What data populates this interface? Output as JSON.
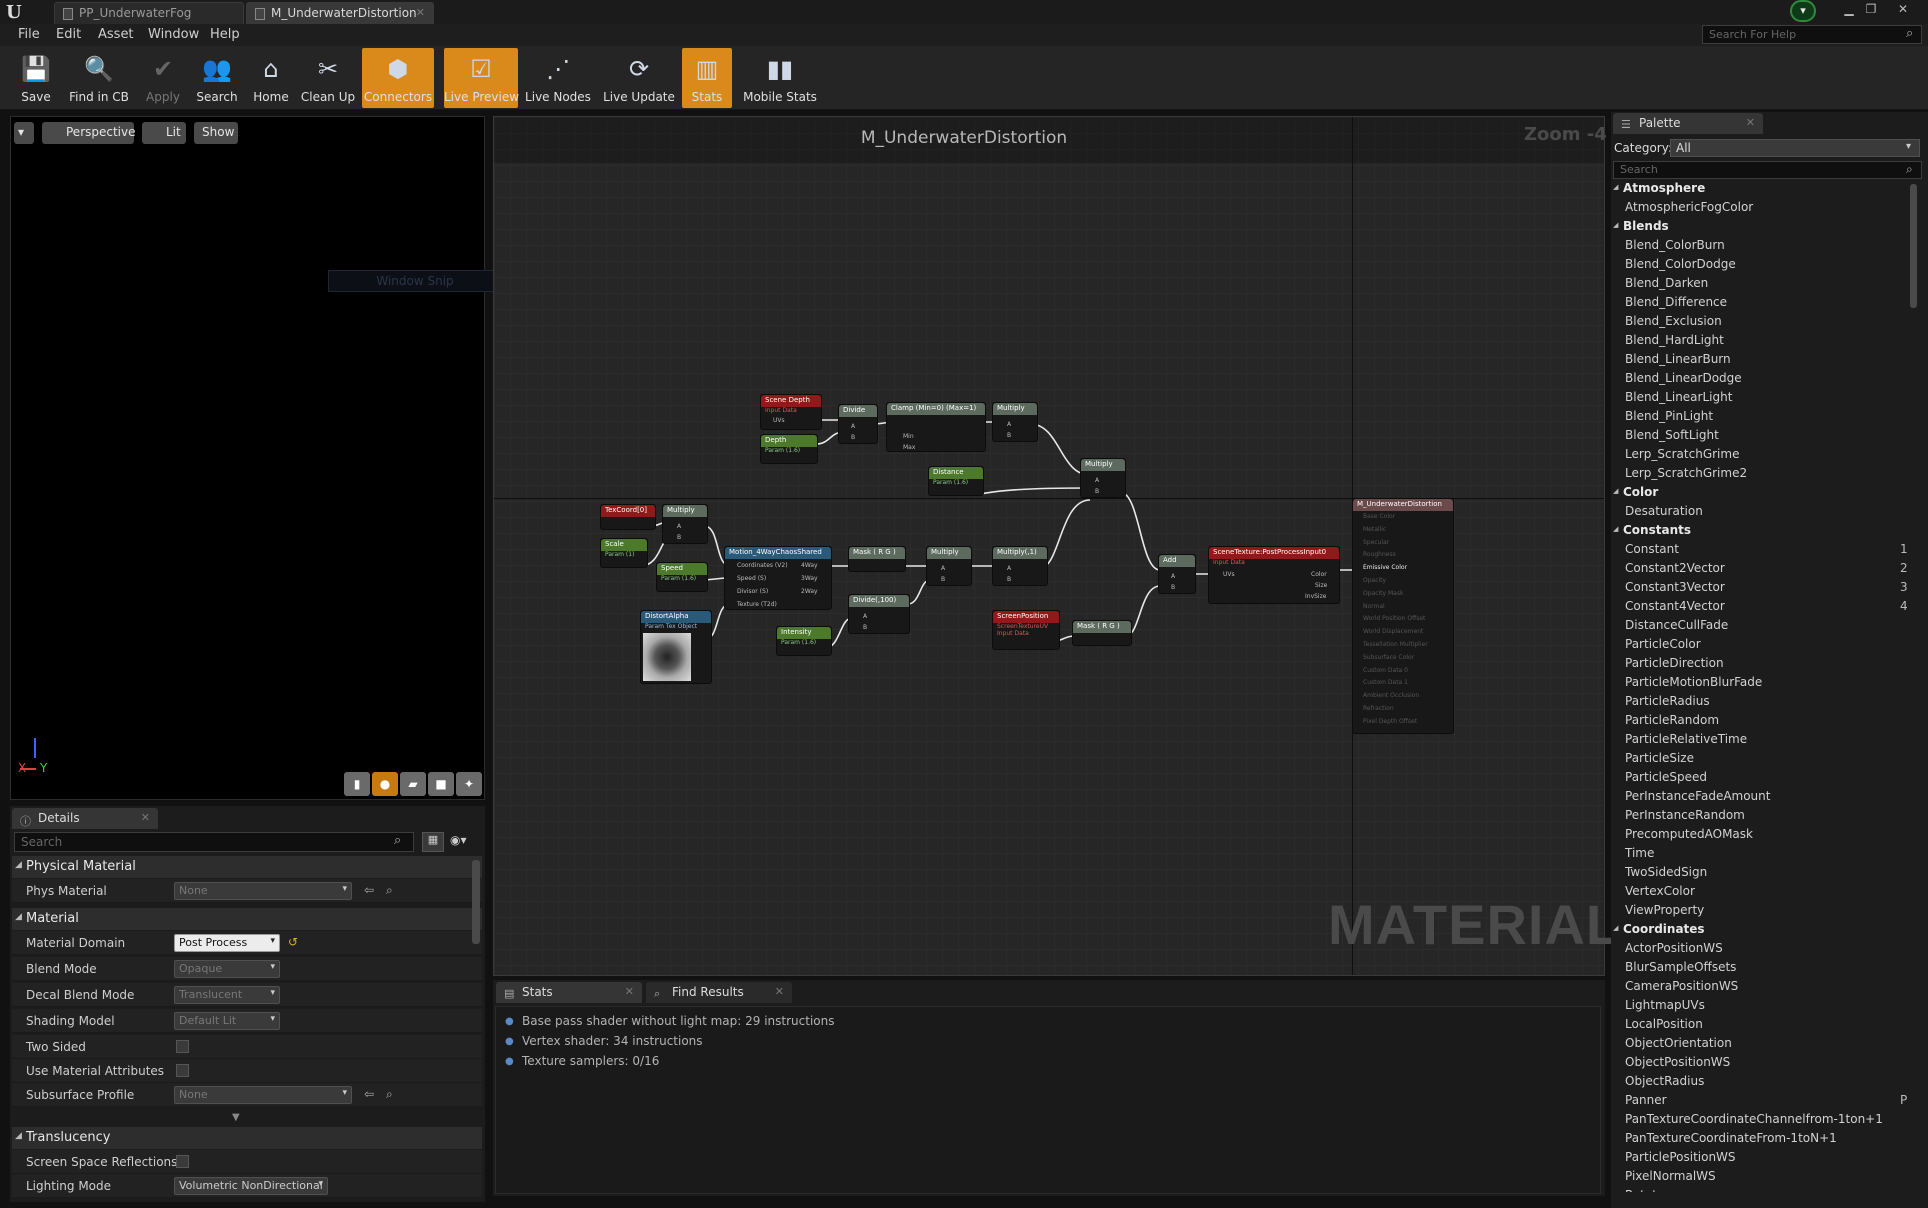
{
  "tabs": [
    {
      "label": "PP_UnderwaterFog"
    },
    {
      "label": "M_UnderwaterDistortion"
    }
  ],
  "window_controls": {
    "minimize": "▁",
    "restore": "❐",
    "close": "✕"
  },
  "menu": [
    "File",
    "Edit",
    "Asset",
    "Window",
    "Help"
  ],
  "help_search": {
    "placeholder": "Search For Help"
  },
  "toolbar": [
    {
      "label": "Save",
      "icon": "save-icon",
      "active": false
    },
    {
      "label": "Find in CB",
      "icon": "find-icon",
      "active": false
    },
    {
      "label": "Apply",
      "icon": "apply-icon",
      "active": false,
      "disabled": true
    },
    {
      "label": "Search",
      "icon": "search-icon",
      "active": false
    },
    {
      "label": "Home",
      "icon": "home-icon",
      "active": false
    },
    {
      "label": "Clean Up",
      "icon": "cleanup-icon",
      "active": false
    },
    {
      "label": "Connectors",
      "icon": "connectors-icon",
      "active": true
    },
    {
      "label": "Live Preview",
      "icon": "live-preview-icon",
      "active": true
    },
    {
      "label": "Live Nodes",
      "icon": "live-nodes-icon",
      "active": false
    },
    {
      "label": "Live Update",
      "icon": "live-update-icon",
      "active": false
    },
    {
      "label": "Stats",
      "icon": "stats-icon",
      "active": true
    },
    {
      "label": "Mobile Stats",
      "icon": "mobile-stats-icon",
      "active": false
    }
  ],
  "viewport": {
    "perspective": "Perspective",
    "lit": "Lit",
    "show": "Show",
    "window_snip": "Window Snip",
    "axis_x": "X",
    "axis_y": "Y"
  },
  "details": {
    "tab": "Details",
    "search_placeholder": "Search",
    "sections": {
      "physical_material": "Physical Material",
      "material": "Material",
      "translucency": "Translucency"
    },
    "rows": {
      "phys_material": {
        "label": "Phys Material",
        "value": "None"
      },
      "material_domain": {
        "label": "Material Domain",
        "value": "Post Process"
      },
      "blend_mode": {
        "label": "Blend Mode",
        "value": "Opaque"
      },
      "decal_blend_mode": {
        "label": "Decal Blend Mode",
        "value": "Translucent"
      },
      "shading_model": {
        "label": "Shading Model",
        "value": "Default Lit"
      },
      "two_sided": {
        "label": "Two Sided"
      },
      "use_material_attributes": {
        "label": "Use Material Attributes"
      },
      "subsurface_profile": {
        "label": "Subsurface Profile",
        "value": "None"
      },
      "screen_space_reflections": {
        "label": "Screen Space Reflections"
      },
      "lighting_mode": {
        "label": "Lighting Mode",
        "value": "Volumetric NonDirectional"
      }
    }
  },
  "graph": {
    "title": "M_UnderwaterDistortion",
    "zoom": "Zoom -4",
    "watermark": "MATERIAL",
    "nodes": {
      "scene_depth": {
        "title": "Scene Depth",
        "sub": "Input Data",
        "pins": [
          "UVs"
        ]
      },
      "depth": {
        "title": "Depth",
        "sub": "Param (1.6)"
      },
      "divide1": {
        "title": "Divide",
        "pins": [
          "A",
          "B"
        ]
      },
      "clamp": {
        "title": "Clamp (Min=0) (Max=1)",
        "pins": [
          "Min",
          "Max"
        ]
      },
      "multiply_top": {
        "title": "Multiply",
        "pins": [
          "A",
          "B"
        ]
      },
      "distance": {
        "title": "Distance",
        "sub": "Param (1.6)"
      },
      "multiply_mid": {
        "title": "Multiply",
        "pins": [
          "A",
          "B"
        ]
      },
      "texcoord": {
        "title": "TexCoord[0]"
      },
      "multiply_uv": {
        "title": "Multiply",
        "pins": [
          "A",
          "B"
        ]
      },
      "scale": {
        "title": "Scale",
        "sub": "Param (1)"
      },
      "speed": {
        "title": "Speed",
        "sub": "Param (1.6)"
      },
      "motion": {
        "title": "Motion_4WayChaosShared",
        "pins": [
          "Coordinates (V2)",
          "Speed (S)",
          "Divisor (S)",
          "Texture (T2d)",
          "4Way",
          "3Way",
          "2Way"
        ]
      },
      "mask_rg1": {
        "title": "Mask ( R G )"
      },
      "divide100": {
        "title": "Divide(,100)",
        "pins": [
          "A",
          "B"
        ]
      },
      "multiply_a": {
        "title": "Multiply",
        "pins": [
          "A",
          "B"
        ]
      },
      "multiply_1": {
        "title": "Multiply(,1)",
        "pins": [
          "A",
          "B"
        ]
      },
      "distort_alpha": {
        "title": "DistortAlpha",
        "sub": "Param Tex Object"
      },
      "intensity": {
        "title": "Intensity",
        "sub": "Param (1.6)"
      },
      "screen_position": {
        "title": "ScreenPosition",
        "sub": "ScreenTextureUV",
        "sub2": "Input Data"
      },
      "mask_rg2": {
        "title": "Mask ( R G )"
      },
      "add": {
        "title": "Add",
        "pins": [
          "A",
          "B"
        ]
      },
      "scene_texture": {
        "title": "SceneTexture:PostProcessInput0",
        "sub": "Input Data",
        "pins": [
          "UVs",
          "Color",
          "Size",
          "InvSize"
        ]
      },
      "result": {
        "title": "M_UnderwaterDistortion",
        "pins": [
          "Base Color",
          "Metallic",
          "Specular",
          "Roughness",
          "Emissive Color",
          "Opacity",
          "Opacity Mask",
          "Normal",
          "World Position Offset",
          "World Displacement",
          "Tessellation Multiplier",
          "Subsurface Color",
          "Custom Data 0",
          "Custom Data 1",
          "Ambient Occlusion",
          "Refraction",
          "Pixel Depth Offset"
        ]
      }
    }
  },
  "bottom": {
    "tabs": [
      {
        "label": "Stats"
      },
      {
        "label": "Find Results"
      }
    ],
    "stats": [
      "Base pass shader without light map: 29 instructions",
      "Vertex shader: 34 instructions",
      "Texture samplers: 0/16"
    ]
  },
  "palette": {
    "tab": "Palette",
    "category_label": "Category:",
    "category_value": "All",
    "search_placeholder": "Search",
    "items": [
      {
        "t": "cat",
        "l": "Atmosphere"
      },
      {
        "t": "i",
        "l": "AtmosphericFogColor"
      },
      {
        "t": "cat",
        "l": "Blends"
      },
      {
        "t": "i",
        "l": "Blend_ColorBurn"
      },
      {
        "t": "i",
        "l": "Blend_ColorDodge"
      },
      {
        "t": "i",
        "l": "Blend_Darken"
      },
      {
        "t": "i",
        "l": "Blend_Difference"
      },
      {
        "t": "i",
        "l": "Blend_Exclusion"
      },
      {
        "t": "i",
        "l": "Blend_HardLight"
      },
      {
        "t": "i",
        "l": "Blend_LinearBurn"
      },
      {
        "t": "i",
        "l": "Blend_LinearDodge"
      },
      {
        "t": "i",
        "l": "Blend_LinearLight"
      },
      {
        "t": "i",
        "l": "Blend_PinLight"
      },
      {
        "t": "i",
        "l": "Blend_SoftLight"
      },
      {
        "t": "i",
        "l": "Lerp_ScratchGrime"
      },
      {
        "t": "i",
        "l": "Lerp_ScratchGrime2"
      },
      {
        "t": "cat",
        "l": "Color"
      },
      {
        "t": "i",
        "l": "Desaturation"
      },
      {
        "t": "cat",
        "l": "Constants"
      },
      {
        "t": "i",
        "l": "Constant",
        "k": "1"
      },
      {
        "t": "i",
        "l": "Constant2Vector",
        "k": "2"
      },
      {
        "t": "i",
        "l": "Constant3Vector",
        "k": "3"
      },
      {
        "t": "i",
        "l": "Constant4Vector",
        "k": "4"
      },
      {
        "t": "i",
        "l": "DistanceCullFade"
      },
      {
        "t": "i",
        "l": "ParticleColor"
      },
      {
        "t": "i",
        "l": "ParticleDirection"
      },
      {
        "t": "i",
        "l": "ParticleMotionBlurFade"
      },
      {
        "t": "i",
        "l": "ParticleRadius"
      },
      {
        "t": "i",
        "l": "ParticleRandom"
      },
      {
        "t": "i",
        "l": "ParticleRelativeTime"
      },
      {
        "t": "i",
        "l": "ParticleSize"
      },
      {
        "t": "i",
        "l": "ParticleSpeed"
      },
      {
        "t": "i",
        "l": "PerInstanceFadeAmount"
      },
      {
        "t": "i",
        "l": "PerInstanceRandom"
      },
      {
        "t": "i",
        "l": "PrecomputedAOMask"
      },
      {
        "t": "i",
        "l": "Time"
      },
      {
        "t": "i",
        "l": "TwoSidedSign"
      },
      {
        "t": "i",
        "l": "VertexColor"
      },
      {
        "t": "i",
        "l": "ViewProperty"
      },
      {
        "t": "cat",
        "l": "Coordinates"
      },
      {
        "t": "i",
        "l": "ActorPositionWS"
      },
      {
        "t": "i",
        "l": "BlurSampleOffsets"
      },
      {
        "t": "i",
        "l": "CameraPositionWS"
      },
      {
        "t": "i",
        "l": "LightmapUVs"
      },
      {
        "t": "i",
        "l": "LocalPosition"
      },
      {
        "t": "i",
        "l": "ObjectOrientation"
      },
      {
        "t": "i",
        "l": "ObjectPositionWS"
      },
      {
        "t": "i",
        "l": "ObjectRadius"
      },
      {
        "t": "i",
        "l": "Panner",
        "k": "P"
      },
      {
        "t": "i",
        "l": "PanTextureCoordinateChannelfrom-1ton+1"
      },
      {
        "t": "i",
        "l": "PanTextureCoordinateFrom-1toN+1"
      },
      {
        "t": "i",
        "l": "ParticlePositionWS"
      },
      {
        "t": "i",
        "l": "PixelNormalWS"
      },
      {
        "t": "i",
        "l": "Rotator"
      }
    ]
  },
  "colors": {
    "accent_orange": "#d98a1a",
    "node_red": "#8e1a1a",
    "node_green": "#4d7a2a"
  }
}
